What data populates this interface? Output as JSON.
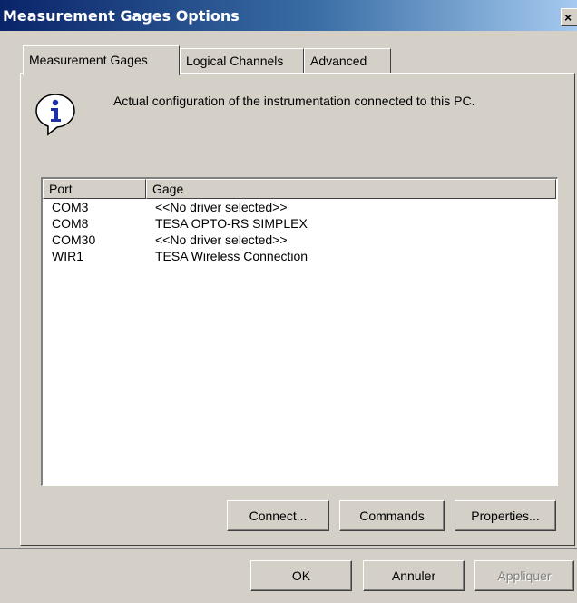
{
  "window": {
    "title": "Measurement Gages Options",
    "close_label": "×"
  },
  "tabs": [
    {
      "label": "Measurement Gages",
      "active": true
    },
    {
      "label": "Logical Channels",
      "active": false
    },
    {
      "label": "Advanced",
      "active": false
    }
  ],
  "info": {
    "icon": "info-icon",
    "text": "Actual configuration of the instrumentation connected to this PC."
  },
  "list": {
    "columns": [
      "Port",
      "Gage"
    ],
    "rows": [
      {
        "port": "COM3",
        "gage": "<<No driver selected>>"
      },
      {
        "port": "COM8",
        "gage": "TESA OPTO-RS SIMPLEX"
      },
      {
        "port": "COM30",
        "gage": "<<No driver selected>>"
      },
      {
        "port": "WIR1",
        "gage": "TESA Wireless Connection"
      }
    ]
  },
  "panel_buttons": {
    "connect": "Connect...",
    "commands": "Commands",
    "properties": "Properties..."
  },
  "dialog_buttons": {
    "ok": "OK",
    "cancel": "Annuler",
    "apply": "Appliquer"
  },
  "colors": {
    "titlebar_start": "#0a246a",
    "titlebar_end": "#a6caf0",
    "face": "#d4d0c8"
  }
}
